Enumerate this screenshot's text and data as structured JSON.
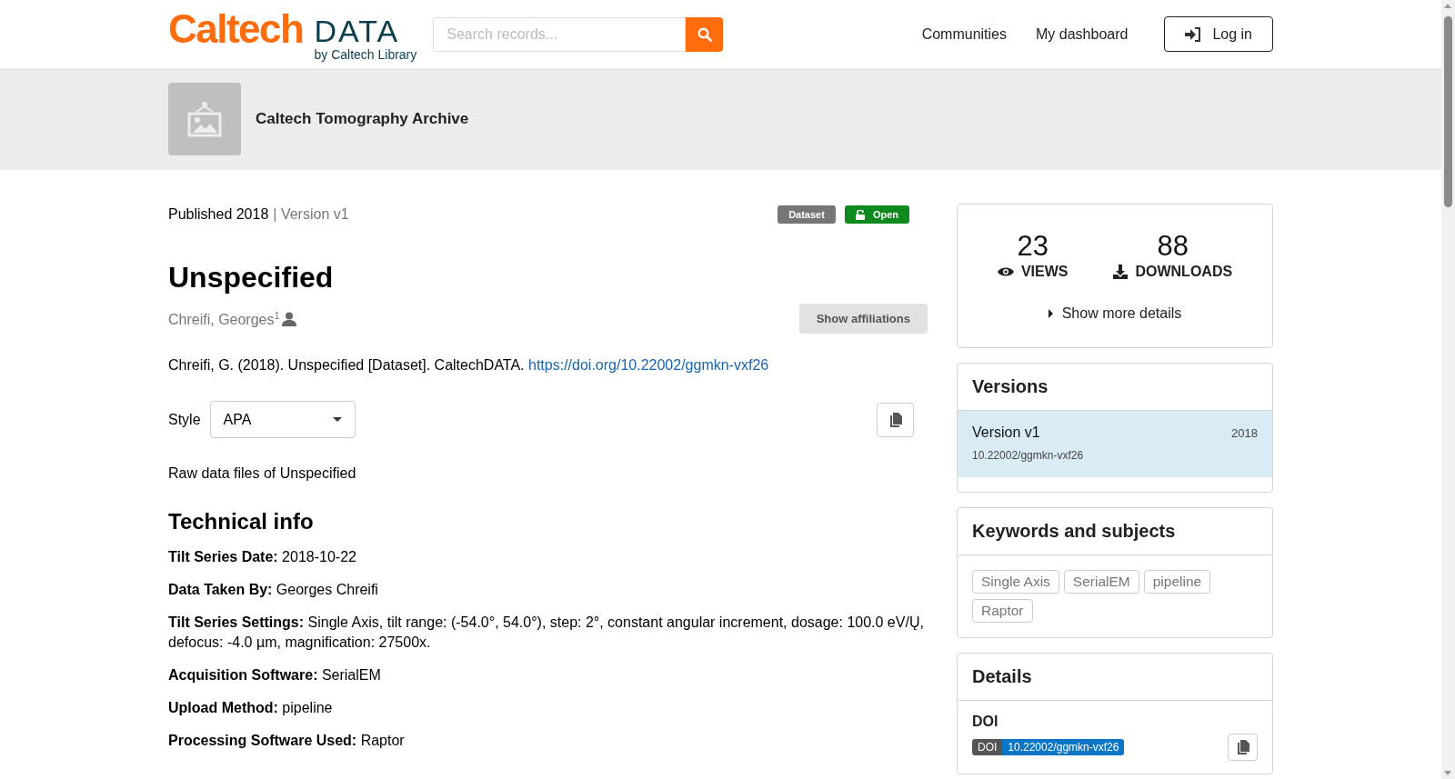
{
  "header": {
    "logo": {
      "main": "Caltech",
      "product": "DATA",
      "tagline": "by Caltech Library"
    },
    "search": {
      "placeholder": "Search records..."
    },
    "nav": [
      "Communities",
      "My dashboard"
    ],
    "login": "Log in"
  },
  "community": {
    "name": "Caltech Tomography Archive"
  },
  "record": {
    "published": "Published 2018",
    "version": "| Version v1",
    "badges": [
      {
        "kind": "type",
        "label": "Dataset"
      },
      {
        "kind": "access",
        "label": "Open"
      }
    ],
    "title": "Unspecified",
    "creator": {
      "name": "Chreifi, Georges",
      "sup": "1"
    },
    "show_affiliations": "Show affiliations",
    "citation": {
      "text": "Chreifi, G. (2018). Unspecified [Dataset]. CaltechDATA.",
      "link": "https://doi.org/10.22002/ggmkn-vxf26"
    },
    "style": {
      "label": "Style",
      "value": "APA"
    },
    "description": "Raw data files of Unspecified",
    "technical_heading": "Technical info",
    "technical": [
      {
        "label": "Tilt Series Date:",
        "value": "2018-10-22"
      },
      {
        "label": "Data Taken By:",
        "value": "Georges Chreifi"
      },
      {
        "label": "Tilt Series Settings:",
        "value": "Single Axis, tilt range: (-54.0°, 54.0°), step: 2°, constant angular increment, dosage: 100.0 eV/Ų, defocus: -4.0 µm, magnification: 27500x."
      },
      {
        "label": "Acquisition Software:",
        "value": "SerialEM"
      },
      {
        "label": "Upload Method:",
        "value": "pipeline"
      },
      {
        "label": "Processing Software Used:",
        "value": "Raptor"
      }
    ]
  },
  "stats": {
    "views": "23",
    "views_label": "VIEWS",
    "downloads": "88",
    "downloads_label": "DOWNLOADS",
    "more": "Show more details"
  },
  "versions": {
    "title": "Versions",
    "items": [
      {
        "name": "Version v1",
        "year": "2018",
        "doi": "10.22002/ggmkn-vxf26",
        "selected": true
      }
    ]
  },
  "keywords": {
    "title": "Keywords and subjects",
    "items": [
      "Single Axis",
      "SerialEM",
      "pipeline",
      "Raptor"
    ]
  },
  "details": {
    "title": "Details",
    "doi_label": "DOI",
    "doi_badge_label": "DOI",
    "doi_value": "10.22002/ggmkn-vxf26"
  }
}
